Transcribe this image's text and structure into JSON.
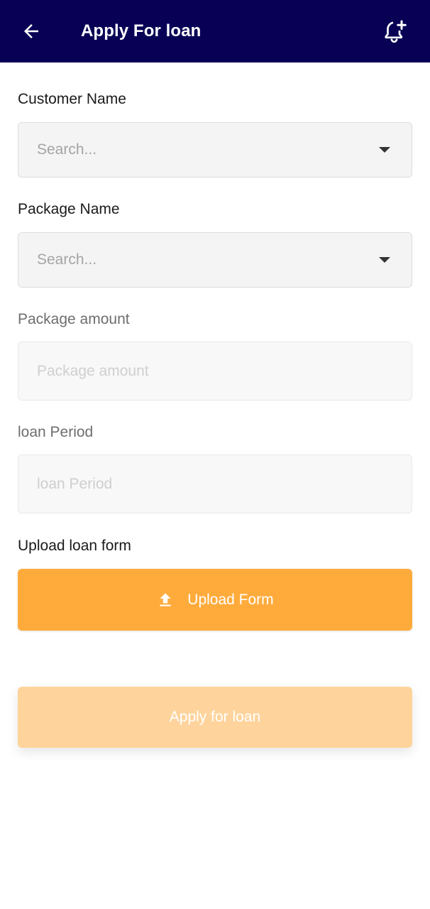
{
  "header": {
    "title": "Apply For loan",
    "back_icon": "arrow-left-icon",
    "action_icon": "bell-plus-icon",
    "background": "#070055"
  },
  "form": {
    "customer_name": {
      "label": "Customer Name",
      "placeholder": "Search...",
      "value": ""
    },
    "package_name": {
      "label": "Package Name",
      "placeholder": "Search...",
      "value": ""
    },
    "package_amount": {
      "label": "Package amount",
      "placeholder": "Package amount",
      "value": ""
    },
    "loan_period": {
      "label": "loan Period",
      "placeholder": "loan Period",
      "value": ""
    },
    "upload": {
      "label": "Upload loan form",
      "button_label": "Upload Form",
      "icon": "upload-icon",
      "color": "#ffab3c"
    }
  },
  "submit": {
    "label": "Apply for loan",
    "color": "#fed49c"
  }
}
